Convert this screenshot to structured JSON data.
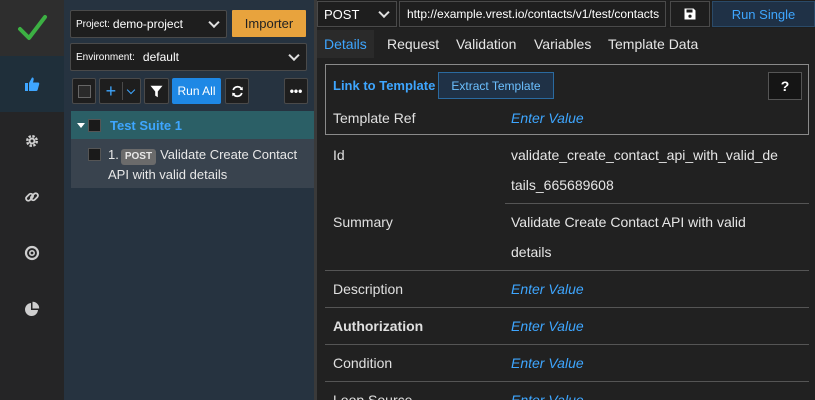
{
  "rail": {
    "items": [
      {
        "name": "test-cases",
        "icon": "thumbs-up-icon",
        "active": true
      },
      {
        "name": "settings",
        "icon": "gear-icon"
      },
      {
        "name": "links",
        "icon": "link-icon"
      },
      {
        "name": "help",
        "icon": "lifebuoy-icon"
      },
      {
        "name": "reports",
        "icon": "pie-chart-icon"
      }
    ]
  },
  "project": {
    "label": "Project:",
    "value": "demo-project"
  },
  "importer_label": "Importer",
  "environment": {
    "label": "Environment:",
    "value": "default"
  },
  "toolbar": {
    "add_label": "+",
    "run_all_label": "Run All",
    "more_label": "•••"
  },
  "suite": {
    "name": "Test Suite 1"
  },
  "test_case": {
    "number": "1.",
    "method": "POST",
    "title": "Validate Create Contact API with valid details"
  },
  "request": {
    "method": "POST",
    "url": "http://example.vrest.io/contacts/v1/test/contacts",
    "run_single_label": "Run Single"
  },
  "tabs": [
    {
      "label": "Details",
      "active": true
    },
    {
      "label": "Request"
    },
    {
      "label": "Validation"
    },
    {
      "label": "Variables"
    },
    {
      "label": "Template Data"
    }
  ],
  "template": {
    "link_label": "Link to Template",
    "extract_label": "Extract Template",
    "help_label": "?",
    "ref_label": "Template Ref",
    "ref_placeholder": "Enter Value"
  },
  "details": {
    "id": {
      "label": "Id",
      "line1": "validate_create_contact_api_with_valid_de",
      "line2": "tails_665689608"
    },
    "summary": {
      "label": "Summary",
      "line1": "Validate Create Contact API with valid",
      "line2": "details"
    },
    "description": {
      "label": "Description",
      "placeholder": "Enter Value"
    },
    "authorization": {
      "label": "Authorization",
      "placeholder": "Enter Value"
    },
    "condition": {
      "label": "Condition",
      "placeholder": "Enter Value"
    },
    "loop_source": {
      "label": "Loop Source",
      "placeholder": "Enter Value"
    }
  },
  "colors": {
    "accent": "#3ea6ff",
    "importer": "#e8a33d",
    "run_all": "#1e88e5",
    "check": "#3cb043"
  }
}
